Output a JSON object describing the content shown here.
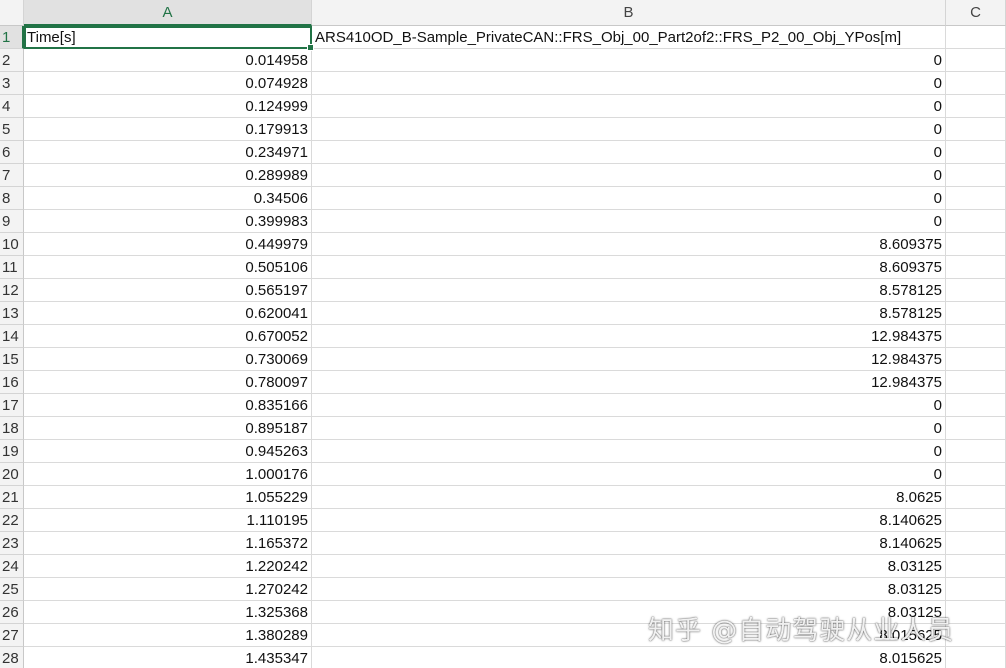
{
  "columns": [
    "A",
    "B",
    "C"
  ],
  "rows": [
    {
      "n": "1",
      "a": "Time[s]",
      "b": "ARS410OD_B-Sample_PrivateCAN::FRS_Obj_00_Part2of2::FRS_P2_00_Obj_YPos[m]"
    },
    {
      "n": "2",
      "a": "0.014958",
      "b": "0"
    },
    {
      "n": "3",
      "a": "0.074928",
      "b": "0"
    },
    {
      "n": "4",
      "a": "0.124999",
      "b": "0"
    },
    {
      "n": "5",
      "a": "0.179913",
      "b": "0"
    },
    {
      "n": "6",
      "a": "0.234971",
      "b": "0"
    },
    {
      "n": "7",
      "a": "0.289989",
      "b": "0"
    },
    {
      "n": "8",
      "a": "0.34506",
      "b": "0"
    },
    {
      "n": "9",
      "a": "0.399983",
      "b": "0"
    },
    {
      "n": "10",
      "a": "0.449979",
      "b": "8.609375"
    },
    {
      "n": "11",
      "a": "0.505106",
      "b": "8.609375"
    },
    {
      "n": "12",
      "a": "0.565197",
      "b": "8.578125"
    },
    {
      "n": "13",
      "a": "0.620041",
      "b": "8.578125"
    },
    {
      "n": "14",
      "a": "0.670052",
      "b": "12.984375"
    },
    {
      "n": "15",
      "a": "0.730069",
      "b": "12.984375"
    },
    {
      "n": "16",
      "a": "0.780097",
      "b": "12.984375"
    },
    {
      "n": "17",
      "a": "0.835166",
      "b": "0"
    },
    {
      "n": "18",
      "a": "0.895187",
      "b": "0"
    },
    {
      "n": "19",
      "a": "0.945263",
      "b": "0"
    },
    {
      "n": "20",
      "a": "1.000176",
      "b": "0"
    },
    {
      "n": "21",
      "a": "1.055229",
      "b": "8.0625"
    },
    {
      "n": "22",
      "a": "1.110195",
      "b": "8.140625"
    },
    {
      "n": "23",
      "a": "1.165372",
      "b": "8.140625"
    },
    {
      "n": "24",
      "a": "1.220242",
      "b": "8.03125"
    },
    {
      "n": "25",
      "a": "1.270242",
      "b": "8.03125"
    },
    {
      "n": "26",
      "a": "1.325368",
      "b": "8.03125"
    },
    {
      "n": "27",
      "a": "1.380289",
      "b": "8.015625"
    },
    {
      "n": "28",
      "a": "1.435347",
      "b": "8.015625"
    }
  ],
  "watermark": "知乎 @自动驾驶从业人员",
  "colors": {
    "accent": "#217346",
    "header_bg": "#f3f3f3",
    "gridline": "#dadada"
  }
}
